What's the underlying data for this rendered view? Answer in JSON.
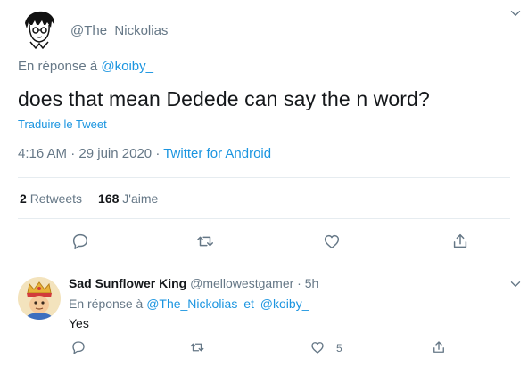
{
  "main_tweet": {
    "handle": "@The_Nickolias",
    "reply_prefix": "En réponse à",
    "reply_to": "@koiby_",
    "text": "does that mean Dedede can say the n word?",
    "translate_label": "Traduire le Tweet",
    "time": "4:16 AM",
    "date": "29 juin 2020",
    "sep": "·",
    "source": "Twitter for Android",
    "retweets_count": "2",
    "retweets_label": "Retweets",
    "likes_count": "168",
    "likes_label": "J'aime",
    "icons": [
      "reply-icon",
      "retweet-icon",
      "like-icon",
      "share-icon",
      "chevron-down-icon"
    ]
  },
  "reply_tweet": {
    "display_name": "Sad Sunflower King",
    "handle": "@mellowestgamer",
    "sep": "·",
    "age": "5h",
    "reply_prefix": "En réponse à",
    "reply_to_1": "@The_Nickolias",
    "reply_and": "et",
    "reply_to_2": "@koiby_",
    "text": "Yes",
    "like_count": "5",
    "icons": [
      "reply-icon",
      "retweet-icon",
      "like-icon",
      "share-icon",
      "chevron-down-icon"
    ]
  },
  "colors": {
    "link": "#1b95e0",
    "secondary_text": "#657786",
    "primary_text": "#14171a",
    "divider": "#e6ecf0"
  }
}
